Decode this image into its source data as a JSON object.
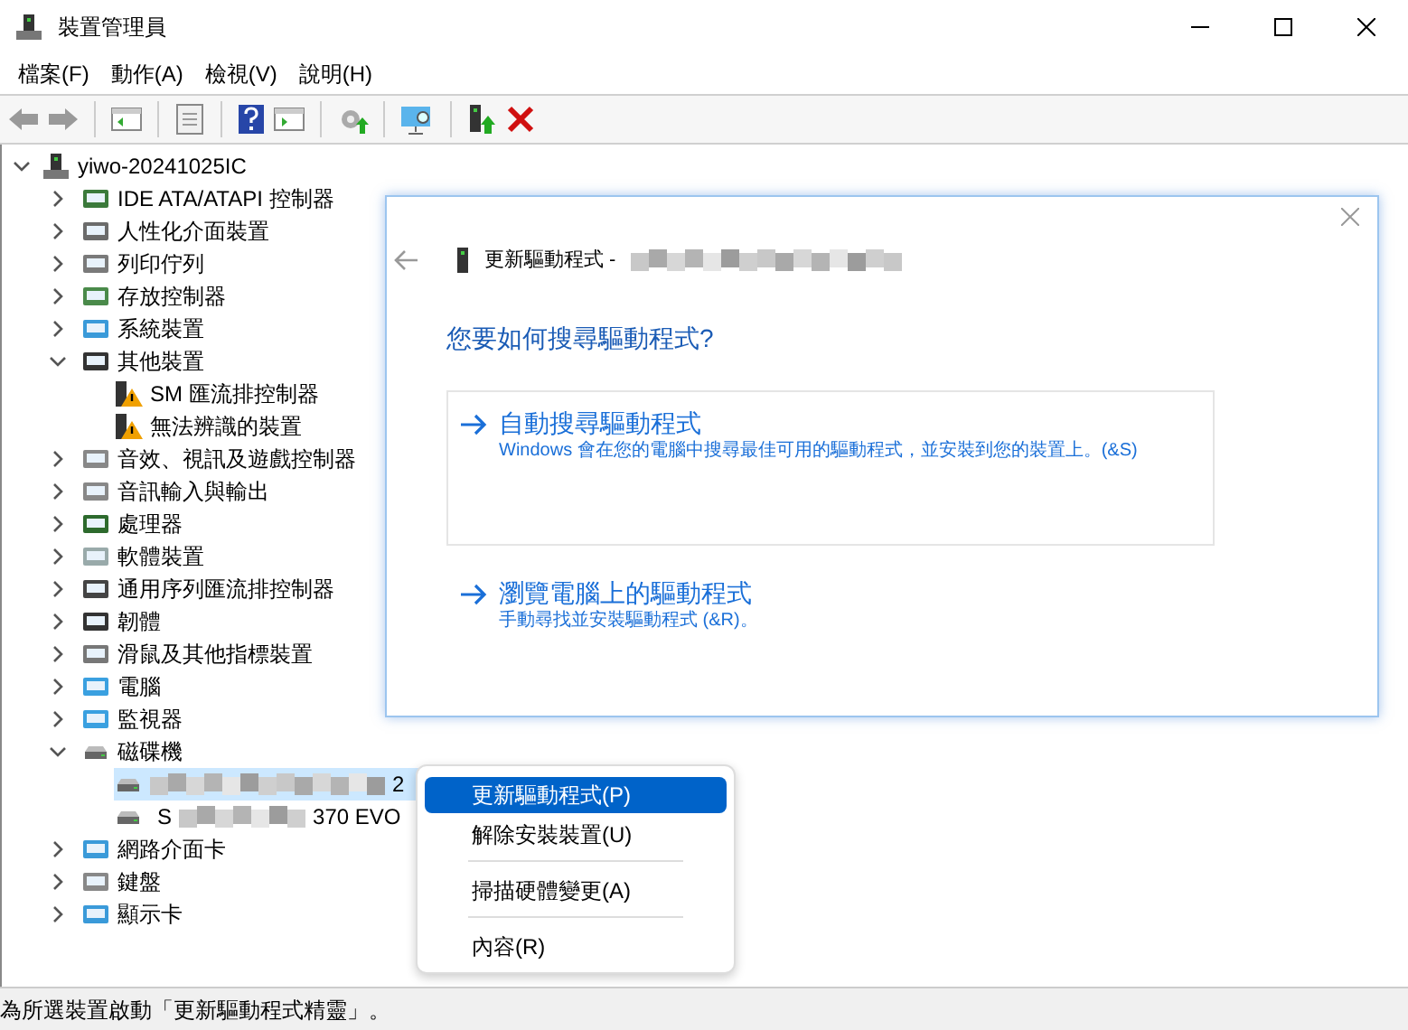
{
  "window": {
    "title": "裝置管理員"
  },
  "menu": [
    "檔案(F)",
    "動作(A)",
    "檢視(V)",
    "說明(H)"
  ],
  "tree": {
    "label": "yiwo-20241025IC",
    "expanded": true,
    "children": [
      {
        "label": "IDE ATA/ATAPI 控制器",
        "expanded": false
      },
      {
        "label": "人性化介面裝置",
        "expanded": false
      },
      {
        "label": "列印佇列",
        "expanded": false
      },
      {
        "label": "存放控制器",
        "expanded": false
      },
      {
        "label": "系統裝置",
        "expanded": false
      },
      {
        "label": "其他裝置",
        "expanded": true,
        "children": [
          {
            "label": "SM 匯流排控制器",
            "warning": true,
            "selected": false
          },
          {
            "label": "無法辨識的裝置",
            "warning": true,
            "selected": false
          }
        ]
      },
      {
        "label": "音效、視訊及遊戲控制器",
        "expanded": false
      },
      {
        "label": "音訊輸入與輸出",
        "expanded": false
      },
      {
        "label": "處理器",
        "expanded": false
      },
      {
        "label": "軟體裝置",
        "expanded": false
      },
      {
        "label": "通用序列匯流排控制器",
        "expanded": false
      },
      {
        "label": "韌體",
        "expanded": false
      },
      {
        "label": "滑鼠及其他指標裝置",
        "expanded": false
      },
      {
        "label": "電腦",
        "expanded": false
      },
      {
        "label": "監視器",
        "expanded": false
      },
      {
        "label": "磁碟機",
        "expanded": true,
        "children": [
          {
            "label_end": "2",
            "warning": false,
            "selected": true
          },
          {
            "label_start": "S",
            "label_end": "370 EVO",
            "warning": false,
            "selected": false
          }
        ]
      },
      {
        "label": "網路介面卡",
        "expanded": false
      },
      {
        "label": "鍵盤",
        "expanded": false
      },
      {
        "label": "顯示卡",
        "expanded": false
      }
    ]
  },
  "dialog": {
    "title": "更新驅動程式 -",
    "heading": "您要如何搜尋驅動程式?",
    "options": [
      {
        "title": "自動搜尋驅動程式",
        "description": "Windows 會在您的電腦中搜尋最佳可用的驅動程式，並安裝到您的裝置上。(&S)",
        "boxed": true
      },
      {
        "title": "瀏覽電腦上的驅動程式",
        "description": "手動尋找並安裝驅動程式 (&R)。",
        "boxed": false
      }
    ]
  },
  "context_menu": [
    {
      "kind": "item",
      "label": "更新驅動程式(P)",
      "selected": true
    },
    {
      "kind": "item",
      "label": "解除安裝裝置(U)",
      "selected": false
    },
    {
      "kind": "separator"
    },
    {
      "kind": "item",
      "label": "掃描硬體變更(A)",
      "selected": false
    },
    {
      "kind": "separator"
    },
    {
      "kind": "item",
      "label": "內容(R)",
      "selected": false
    }
  ],
  "status_bar": "為所選裝置啟動「更新驅動程式精靈」。"
}
